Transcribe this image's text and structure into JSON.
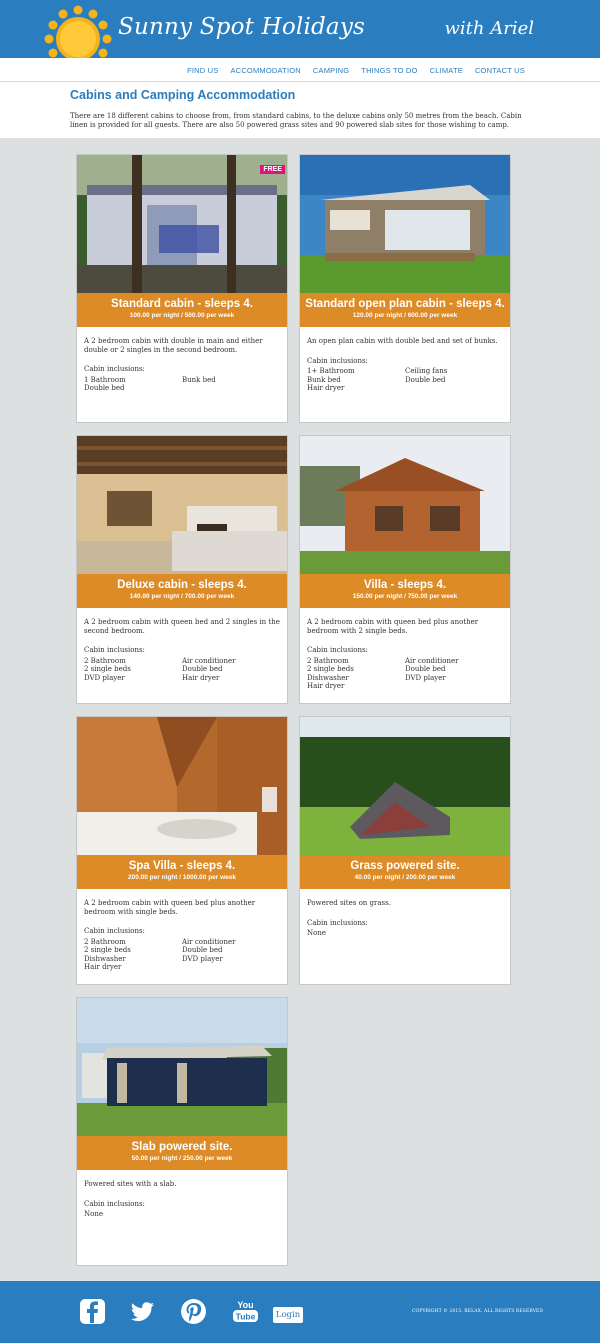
{
  "site": {
    "title": "Sunny Spot Holidays",
    "tagline": "with Ariel"
  },
  "nav": [
    "FIND US",
    "ACCOMMODATION",
    "CAMPING",
    "THINGS TO DO",
    "CLIMATE",
    "CONTACT US"
  ],
  "intro": {
    "heading": "Cabins and Camping Accommodation",
    "text": "There are 18 different cabins to choose from, from standard cabins, to the deluxe cabins only 50 metres from the beach. Cabin linen is provided for all guests. There are also 50 powered grass sites and 90 powered slab sites for those wishing to camp."
  },
  "cards": [
    {
      "title": "Standard cabin - sleeps 4.",
      "price": "100.00 per night / 500.00 per week",
      "description": "A 2 bedroom cabin with double in main and either double or 2 singles in the second bedroom.",
      "inclusions_label": "Cabin inclusions:",
      "inclusions": [
        "1 Bathroom",
        "Bunk bed",
        "Double bed"
      ],
      "badge": "FREE"
    },
    {
      "title": "Standard open plan cabin - sleeps 4.",
      "price": "120.00 per night / 600.00 per week",
      "description": "An open plan cabin with double bed and set of bunks.",
      "inclusions_label": "Cabin inclusions:",
      "inclusions": [
        "1+ Bathroom",
        "Ceiling fans",
        "Bunk bed",
        "Double bed",
        "Hair dryer"
      ]
    },
    {
      "title": "Deluxe cabin - sleeps 4.",
      "price": "140.00 per night / 700.00 per week",
      "description": "A 2 bedroom cabin with queen bed and 2 singles in the second bedroom.",
      "inclusions_label": "Cabin inclusions:",
      "inclusions": [
        "2 Bathroom",
        "Air conditioner",
        "2 single beds",
        "Double bed",
        "DVD player",
        "Hair dryer"
      ]
    },
    {
      "title": "Villa - sleeps 4.",
      "price": "150.00 per night / 750.00 per week",
      "description": "A 2 bedroom cabin with queen bed plus another bedroom with 2 single beds.",
      "inclusions_label": "Cabin inclusions:",
      "inclusions": [
        "2 Bathroom",
        "Air conditioner",
        "2 single beds",
        "Double bed",
        "Dishwasher",
        "DVD player",
        "Hair dryer"
      ]
    },
    {
      "title": "Spa Villa - sleeps 4.",
      "price": "200.00 per night / 1000.00 per week",
      "description": "A 2 bedroom cabin with queen bed plus another bedroom with single beds.",
      "inclusions_label": "Cabin inclusions:",
      "inclusions": [
        "2 Bathroom",
        "Air conditioner",
        "2 single beds",
        "Double bed",
        "Dishwasher",
        "DVD player",
        "Hair dryer"
      ]
    },
    {
      "title": "Grass powered site.",
      "price": "40.00 per night / 200.00 per week",
      "description": "Powered sites on grass.",
      "inclusions_label": "Cabin inclusions:",
      "inclusions": [
        "None"
      ]
    },
    {
      "title": "Slab powered site.",
      "price": "50.00 per night / 250.00 per week",
      "description": "Powered sites with a slab.",
      "inclusions_label": "Cabin inclusions:",
      "inclusions": [
        "None"
      ]
    }
  ],
  "footer": {
    "social": [
      "facebook-icon",
      "twitter-icon",
      "pinterest-icon",
      "youtube-icon"
    ],
    "youtube_text_top": "You",
    "youtube_text_bottom": "Tube",
    "login": "Login",
    "copyright": "COPYRIGHT © 2015. RELAX. ALL RIGHTS RESERVED"
  }
}
